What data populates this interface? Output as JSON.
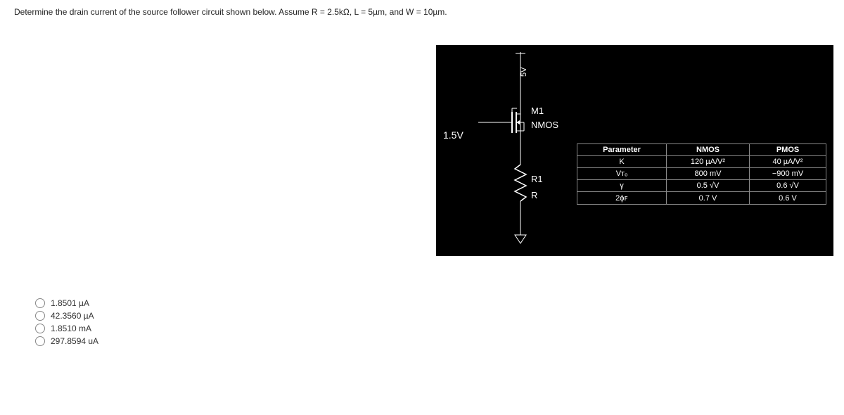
{
  "question": "Determine the drain current of the source follower circuit shown below. Assume R = 2.5kΩ, L = 5µm, and W = 10µm.",
  "circuit": {
    "vdd": "5V",
    "vin": "1.5V",
    "mosfet_label": "M1",
    "mosfet_type": "NMOS",
    "resistor_label": "R1",
    "resistor_value": "R"
  },
  "param_table": {
    "headers": [
      "Parameter",
      "NMOS",
      "PMOS"
    ],
    "rows": [
      {
        "p": "K",
        "n": "120 µA/V²",
        "m": "40 µA/V²"
      },
      {
        "p": "Vᴛₒ",
        "n": "800 mV",
        "m": "−900 mV"
      },
      {
        "p": "γ",
        "n": "0.5 √V",
        "m": "0.6 √V"
      },
      {
        "p": "2ϕꜰ",
        "n": "0.7 V",
        "m": "0.6 V"
      }
    ]
  },
  "options": [
    "1.8501 µA",
    "42.3560 µA",
    "1.8510 mA",
    "297.8594 uA"
  ]
}
